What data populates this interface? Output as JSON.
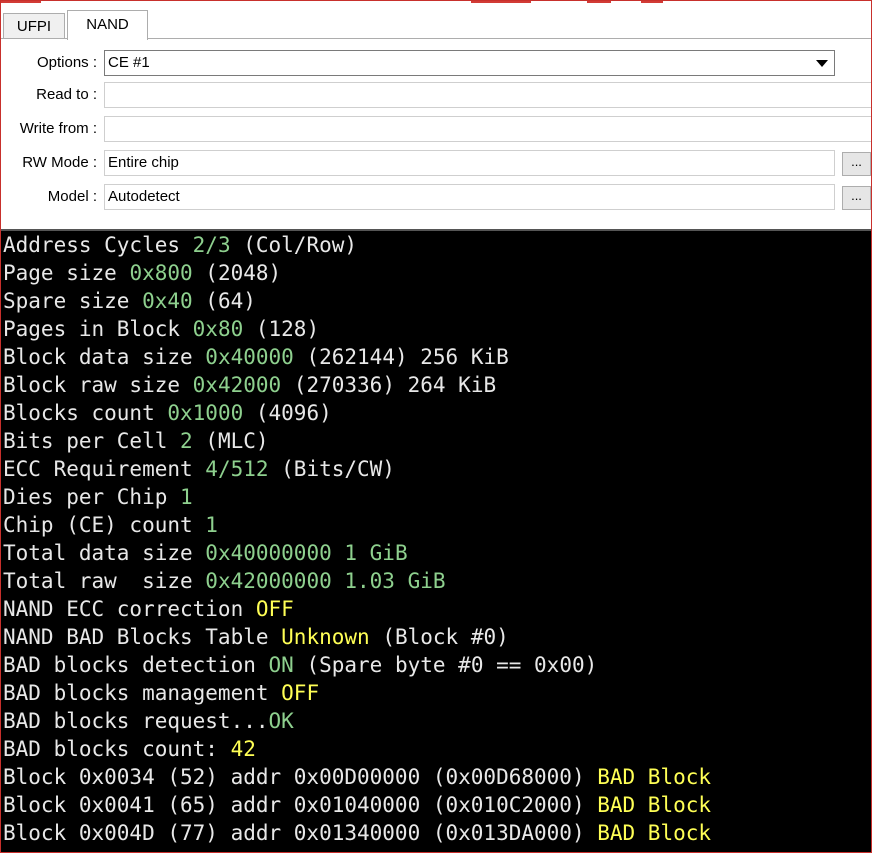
{
  "tabs": [
    "UFPI",
    "NAND"
  ],
  "form": {
    "options_label": "Options :",
    "options_value": "CE #1",
    "read_label": "Read to :",
    "read_value": "",
    "write_label": "Write from :",
    "write_value": "",
    "rw_label": "RW Mode :",
    "rw_value": "Entire chip",
    "model_label": "Model :",
    "model_value": "Autodetect",
    "browse_label": "..."
  },
  "console_lines": [
    [
      {
        "t": "Address Cycles "
      },
      {
        "t": "2/3",
        "c": "g"
      },
      {
        "t": " (Col/Row)"
      }
    ],
    [
      {
        "t": "Page size "
      },
      {
        "t": "0x800",
        "c": "g"
      },
      {
        "t": " (2048)"
      }
    ],
    [
      {
        "t": "Spare size "
      },
      {
        "t": "0x40",
        "c": "g"
      },
      {
        "t": " (64)"
      }
    ],
    [
      {
        "t": "Pages in Block "
      },
      {
        "t": "0x80",
        "c": "g"
      },
      {
        "t": " (128)"
      }
    ],
    [
      {
        "t": "Block data size "
      },
      {
        "t": "0x40000",
        "c": "g"
      },
      {
        "t": " (262144) 256 KiB"
      }
    ],
    [
      {
        "t": "Block raw size "
      },
      {
        "t": "0x42000",
        "c": "g"
      },
      {
        "t": " (270336) 264 KiB"
      }
    ],
    [
      {
        "t": "Blocks count "
      },
      {
        "t": "0x1000",
        "c": "g"
      },
      {
        "t": " (4096)"
      }
    ],
    [
      {
        "t": "Bits per Cell "
      },
      {
        "t": "2",
        "c": "g"
      },
      {
        "t": " (MLC)"
      }
    ],
    [
      {
        "t": "ECC Requirement "
      },
      {
        "t": "4/512",
        "c": "g"
      },
      {
        "t": " (Bits/CW)"
      }
    ],
    [
      {
        "t": "Dies per Chip "
      },
      {
        "t": "1",
        "c": "g"
      }
    ],
    [
      {
        "t": "Chip (CE) count "
      },
      {
        "t": "1",
        "c": "g"
      }
    ],
    [
      {
        "t": "Total data size "
      },
      {
        "t": "0x40000000 1 GiB",
        "c": "g"
      }
    ],
    [
      {
        "t": "Total raw  size "
      },
      {
        "t": "0x42000000 1.03 GiB",
        "c": "g"
      }
    ],
    [
      {
        "t": "NAND ECC correction "
      },
      {
        "t": "OFF",
        "c": "y"
      }
    ],
    [
      {
        "t": "NAND BAD Blocks Table "
      },
      {
        "t": "Unknown",
        "c": "y"
      },
      {
        "t": " (Block #0)"
      }
    ],
    [
      {
        "t": "BAD blocks detection "
      },
      {
        "t": "ON",
        "c": "g"
      },
      {
        "t": " (Spare byte #0 == 0x00)"
      }
    ],
    [
      {
        "t": "BAD blocks management "
      },
      {
        "t": "OFF",
        "c": "y"
      }
    ],
    [
      {
        "t": "BAD blocks request..."
      },
      {
        "t": "OK",
        "c": "g"
      }
    ],
    [
      {
        "t": "BAD blocks count: "
      },
      {
        "t": "42",
        "c": "y"
      }
    ],
    [
      {
        "t": "Block 0x0034 (52) addr 0x00D00000 (0x00D68000) "
      },
      {
        "t": "BAD Block",
        "c": "y"
      }
    ],
    [
      {
        "t": "Block 0x0041 (65) addr 0x01040000 (0x010C2000) "
      },
      {
        "t": "BAD Block",
        "c": "y"
      }
    ],
    [
      {
        "t": "Block 0x004D (77) addr 0x01340000 (0x013DA000) "
      },
      {
        "t": "BAD Block",
        "c": "y"
      }
    ]
  ],
  "colors": {
    "green": "#8ed08e",
    "yellow": "#ffff55",
    "console_bg": "#000000",
    "frame_border": "#c8302c"
  }
}
